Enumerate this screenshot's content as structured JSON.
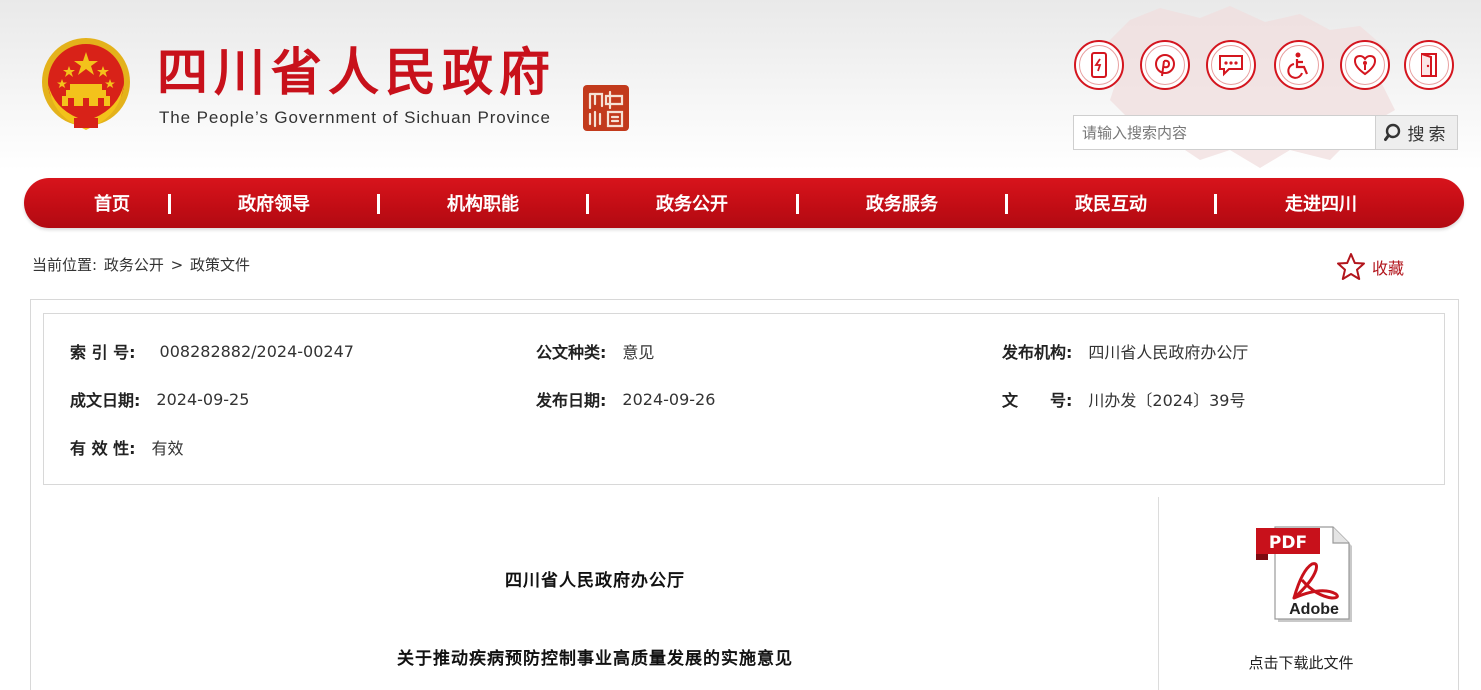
{
  "header": {
    "title_cn": "四川省人民政府",
    "title_en": "The People’s Government of Sichuan Province",
    "seal_text": "中國四川",
    "tool_icons": [
      "mobile-icon",
      "pinterest-icon",
      "chat-icon",
      "accessibility-icon",
      "elderly-care-icon",
      "exit-icon"
    ],
    "search": {
      "placeholder": "请输入搜索内容",
      "button_label": "搜索"
    }
  },
  "nav": {
    "items": [
      {
        "label": "首页"
      },
      {
        "label": "政府领导"
      },
      {
        "label": "机构职能"
      },
      {
        "label": "政务公开"
      },
      {
        "label": "政务服务"
      },
      {
        "label": "政民互动"
      },
      {
        "label": "走进四川"
      }
    ]
  },
  "breadcrumb": {
    "prefix": "当前位置:",
    "items": [
      "政务公开",
      "政策文件"
    ],
    "separator": ">"
  },
  "favorite": {
    "label": "收藏"
  },
  "meta": {
    "index_label": "索 引 号:",
    "index_value": "008282882/2024-00247",
    "type_label": "公文种类:",
    "type_value": "意见",
    "issuer_label": "发布机构:",
    "issuer_value": "四川省人民政府办公厅",
    "written_label": "成文日期:",
    "written_value": "2024-09-25",
    "published_label": "发布日期:",
    "published_value": "2024-09-26",
    "docno_label": "文　　号:",
    "docno_value": "川办发〔2024〕39号",
    "validity_label": "有 效 性:",
    "validity_value": "有效"
  },
  "document": {
    "org": "四川省人民政府办公厅",
    "title": "关于推动疾病预防控制事业高质量发展的实施意见"
  },
  "download": {
    "badge": "PDF",
    "brand": "Adobe",
    "label": "点击下载此文件"
  },
  "colors": {
    "brand_red": "#c8111b",
    "nav_red": "#c30d15",
    "gold": "#f3c21b"
  }
}
